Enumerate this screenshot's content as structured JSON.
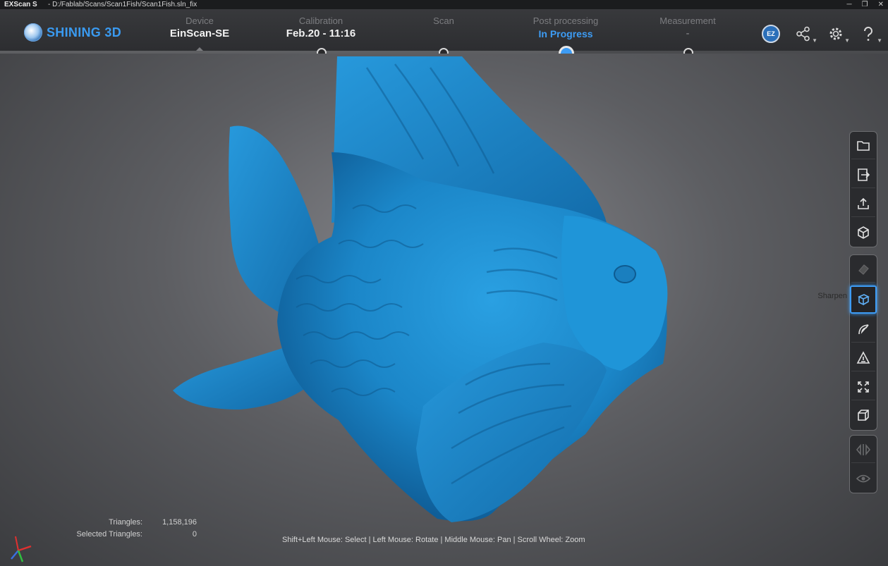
{
  "window": {
    "app_name": "EXScan S",
    "path": "-   D:/Fablab/Scans/Scan1Fish/Scan1Fish.sln_fix",
    "minimize": "─",
    "maximize": "❐",
    "close": "✕"
  },
  "brand": {
    "name": "SHINING 3D",
    "color": "#3a9af0"
  },
  "steps": [
    {
      "label": "Device",
      "value": "EinScan-SE"
    },
    {
      "label": "Calibration",
      "value": "Feb.20 - 11:16"
    },
    {
      "label": "Scan",
      "value": ""
    },
    {
      "label": "Post processing",
      "value": "In Progress",
      "active": true
    },
    {
      "label": "Measurement",
      "value": "-"
    }
  ],
  "header_icons": [
    {
      "name": "ez-icon",
      "text": "EZ"
    },
    {
      "name": "share-icon"
    },
    {
      "name": "settings-icon"
    },
    {
      "name": "help-icon"
    }
  ],
  "toolbar_groups": [
    [
      "folder-open-icon",
      "export-icon",
      "upload-icon",
      "cube-icon"
    ],
    [
      "eraser-icon",
      "sharpen-icon",
      "curve-icon",
      "warning-triangle-icon",
      "expand-icon",
      "wireframe-cube-icon"
    ],
    [
      "mirror-icon",
      "eye-icon"
    ]
  ],
  "tooltip": "Sharpen",
  "stats": {
    "triangles_label": "Triangles:",
    "triangles_value": "1,158,196",
    "selected_label": "Selected Triangles:",
    "selected_value": "0"
  },
  "hint": "Shift+Left Mouse: Select | Left Mouse: Rotate | Middle Mouse: Pan | Scroll Wheel: Zoom",
  "colors": {
    "accent": "#3d9cf5",
    "model": "#1e8fd2"
  }
}
